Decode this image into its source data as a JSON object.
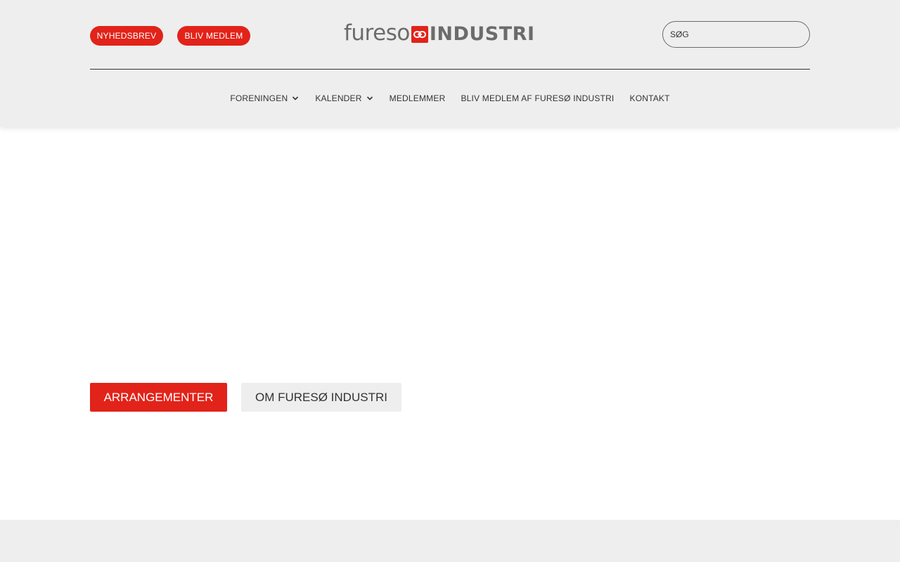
{
  "header": {
    "newsletter_label": "NYHEDSBREV",
    "become_member_label": "BLIV MEDLEM",
    "logo": {
      "fureso_text": "fureso",
      "industri_text": "INDUSTRI",
      "mark_icon": "link-chain-icon"
    },
    "search": {
      "placeholder": "SØG",
      "value": ""
    }
  },
  "nav": {
    "items": [
      {
        "label": "FORENINGEN",
        "has_dropdown": true
      },
      {
        "label": "KALENDER",
        "has_dropdown": true
      },
      {
        "label": "MEDLEMMER",
        "has_dropdown": false
      },
      {
        "label": "BLIV MEDLEM AF FURESØ INDUSTRI",
        "has_dropdown": false
      },
      {
        "label": "KONTAKT",
        "has_dropdown": false
      }
    ]
  },
  "main": {
    "buttons": {
      "events_label": "ARRANGEMENTER",
      "about_label": "OM FURESØ INDUSTRI"
    }
  },
  "colors": {
    "accent": "#e2231a",
    "header_bg": "#eeeeee",
    "text": "#333333",
    "logo_gray": "#6b6b6b"
  }
}
